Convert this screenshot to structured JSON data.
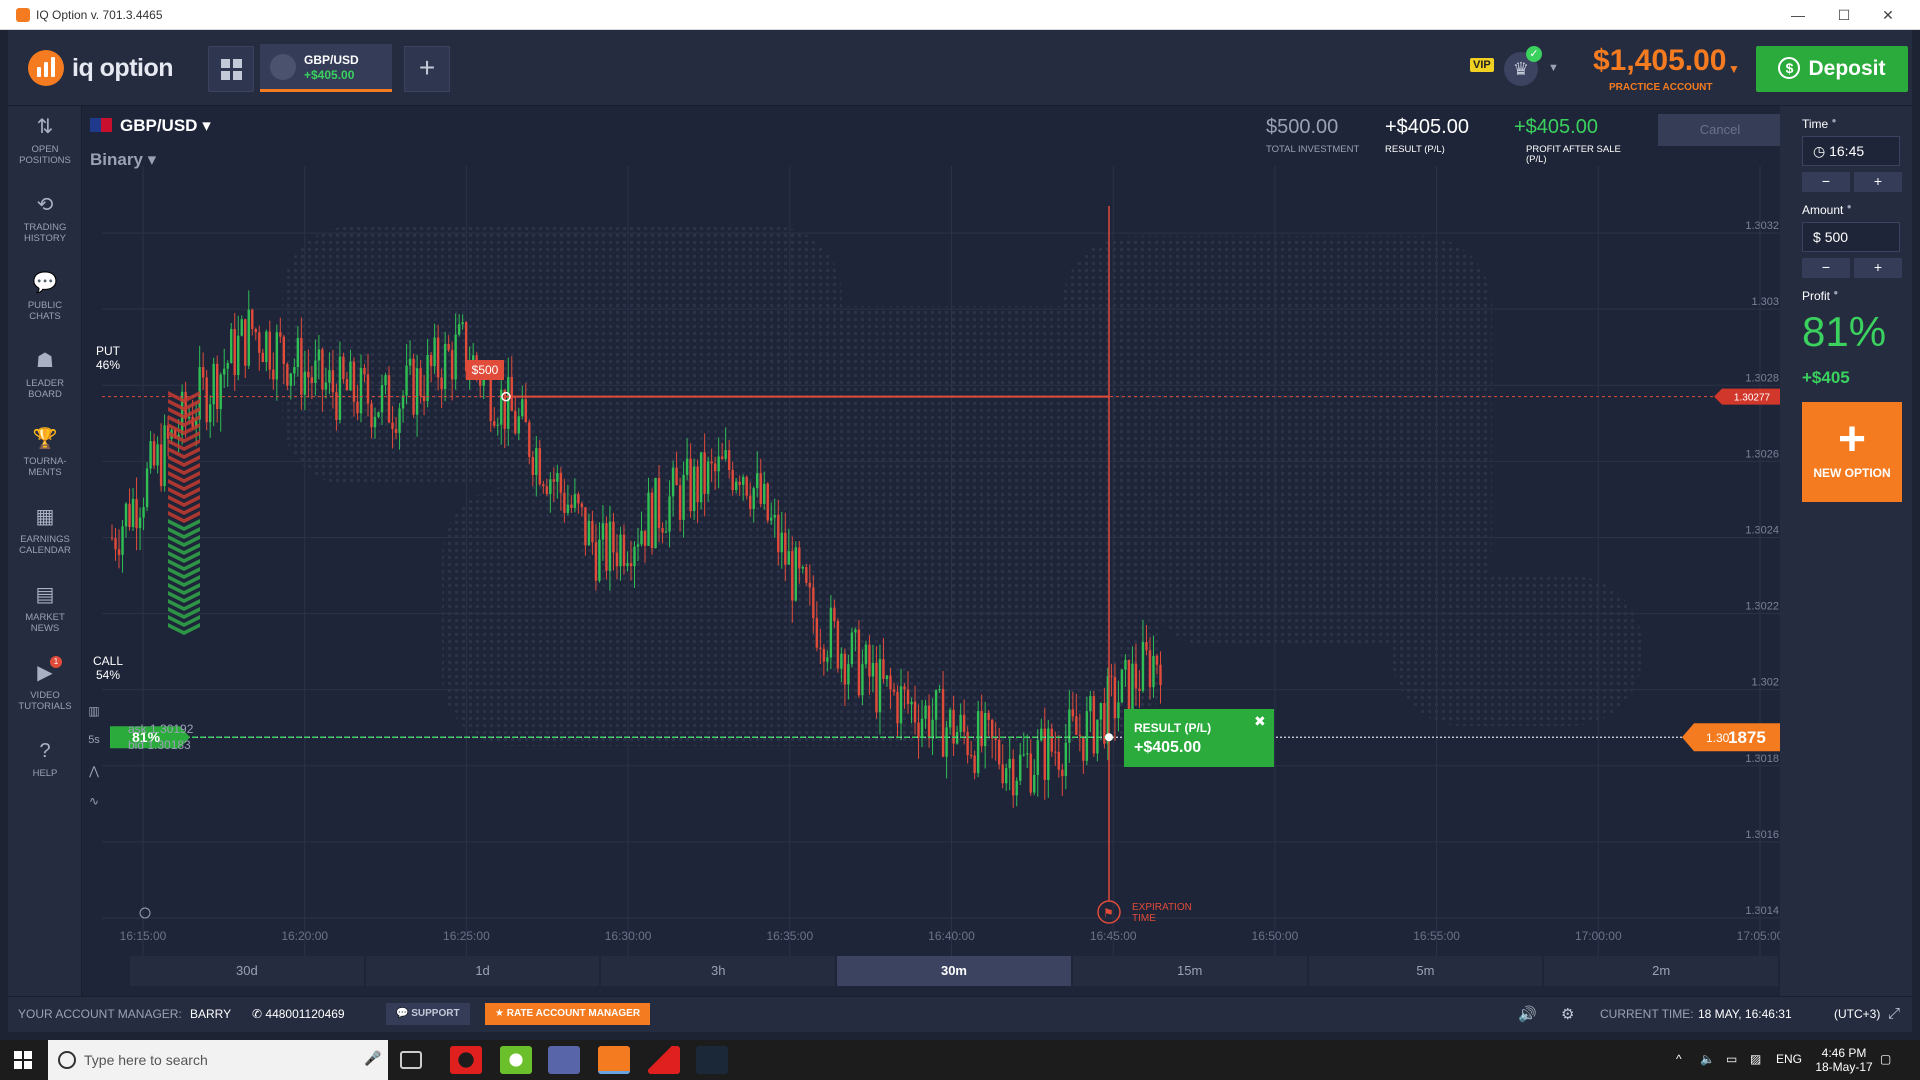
{
  "window": {
    "title": "IQ Option v. 701.3.4465"
  },
  "header": {
    "logo_text": "iq option",
    "asset_tab": {
      "name": "GBP/USD",
      "pl": "+$405.00"
    },
    "vip_badge": "VIP",
    "balance": "$1,405.00",
    "balance_label": "PRACTICE ACCOUNT",
    "deposit_label": "Deposit"
  },
  "sidebar": {
    "items": [
      {
        "icon": "swap-arrows-icon",
        "line1": "OPEN",
        "line2": "POSITIONS"
      },
      {
        "icon": "history-icon",
        "line1": "TRADING",
        "line2": "HISTORY"
      },
      {
        "icon": "chat-icon",
        "line1": "PUBLIC",
        "line2": "CHATS"
      },
      {
        "icon": "leaderboard-icon",
        "line1": "LEADER",
        "line2": "BOARD"
      },
      {
        "icon": "trophy-icon",
        "line1": "TOURNA-",
        "line2": "MENTS"
      },
      {
        "icon": "calendar-icon",
        "line1": "EARNINGS",
        "line2": "CALENDAR"
      },
      {
        "icon": "news-icon",
        "line1": "MARKET",
        "line2": "NEWS"
      },
      {
        "icon": "video-icon",
        "line1": "VIDEO",
        "line2": "TUTORIALS",
        "badge": "1"
      },
      {
        "icon": "help-icon",
        "line1": "HELP",
        "line2": ""
      }
    ]
  },
  "chart_panel": {
    "asset": "GBP/USD",
    "mode": "Binary",
    "total_investment": "$500.00",
    "total_investment_label": "TOTAL INVESTMENT",
    "result": "+$405.00",
    "result_label": "RESULT (P/L)",
    "profit_after_sale": "+$405.00",
    "profit_after_sale_label": "PROFIT AFTER SALE (P/L)",
    "cancel_label": "Cancel",
    "put_label": "PUT",
    "put_pct": "46%",
    "call_label": "CALL",
    "call_pct": "54%",
    "payout_badge": "81%",
    "deal_tag": "$500",
    "strike_tag": "1.30277",
    "current_price_prefix": "1.30",
    "current_price_suffix": "1875",
    "result_popup_title": "RESULT (P/L)",
    "result_popup_value": "+$405.00",
    "expiration_label": "EXPIRATION TIME",
    "ask": "ask 1.30192",
    "bid": "bid 1.30183",
    "chart_tool_interval": "5s"
  },
  "chart_data": {
    "type": "candlestick",
    "x_labels": [
      "16:15:00",
      "16:20:00",
      "16:25:00",
      "16:30:00",
      "16:35:00",
      "16:40:00",
      "16:45:00",
      "16:50:00",
      "16:55:00",
      "17:00:00",
      "17:05:00"
    ],
    "y_labels": [
      "1.3032",
      "1.303",
      "1.3028",
      "1.3026",
      "1.3024",
      "1.3022",
      "1.302",
      "1.3018",
      "1.3016",
      "1.3014"
    ],
    "ylim": [
      1.3013,
      1.30335
    ],
    "strike": 1.30277,
    "current": 1.301875,
    "trend": [
      1.3024,
      1.3027,
      1.30295,
      1.3028,
      1.30275,
      1.3029,
      1.30265,
      1.30235,
      1.3025,
      1.3026,
      1.3022,
      1.302,
      1.3019,
      1.3018,
      1.3019,
      1.3021
    ]
  },
  "right_panel": {
    "time_label": "Time",
    "time_value": "16:45",
    "amount_label": "Amount",
    "amount_currency": "$",
    "amount_value": "500",
    "profit_label": "Profit",
    "profit_pct": "81%",
    "profit_amount": "+$405",
    "new_option_label": "NEW OPTION",
    "minus": "−",
    "plus": "+"
  },
  "timeframes": [
    "30d",
    "1d",
    "3h",
    "30m",
    "15m",
    "5m",
    "2m"
  ],
  "active_timeframe": "30m",
  "bottom_bar": {
    "manager_label": "YOUR ACCOUNT MANAGER:",
    "manager_name": "BARRY",
    "phone": "448001120469",
    "support_label": "SUPPORT",
    "rate_label": "RATE ACCOUNT MANAGER",
    "current_time_label": "CURRENT TIME:",
    "current_time_value": "18 MAY, 16:46:31",
    "timezone": "(UTC+3)"
  },
  "taskbar": {
    "search_placeholder": "Type here to search",
    "language": "ENG",
    "clock_time": "4:46 PM",
    "clock_date": "18-May-17"
  },
  "colors": {
    "accent": "#f47b20",
    "green": "#3ad15e",
    "red": "#e04b3a",
    "bg": "#1f2538"
  }
}
